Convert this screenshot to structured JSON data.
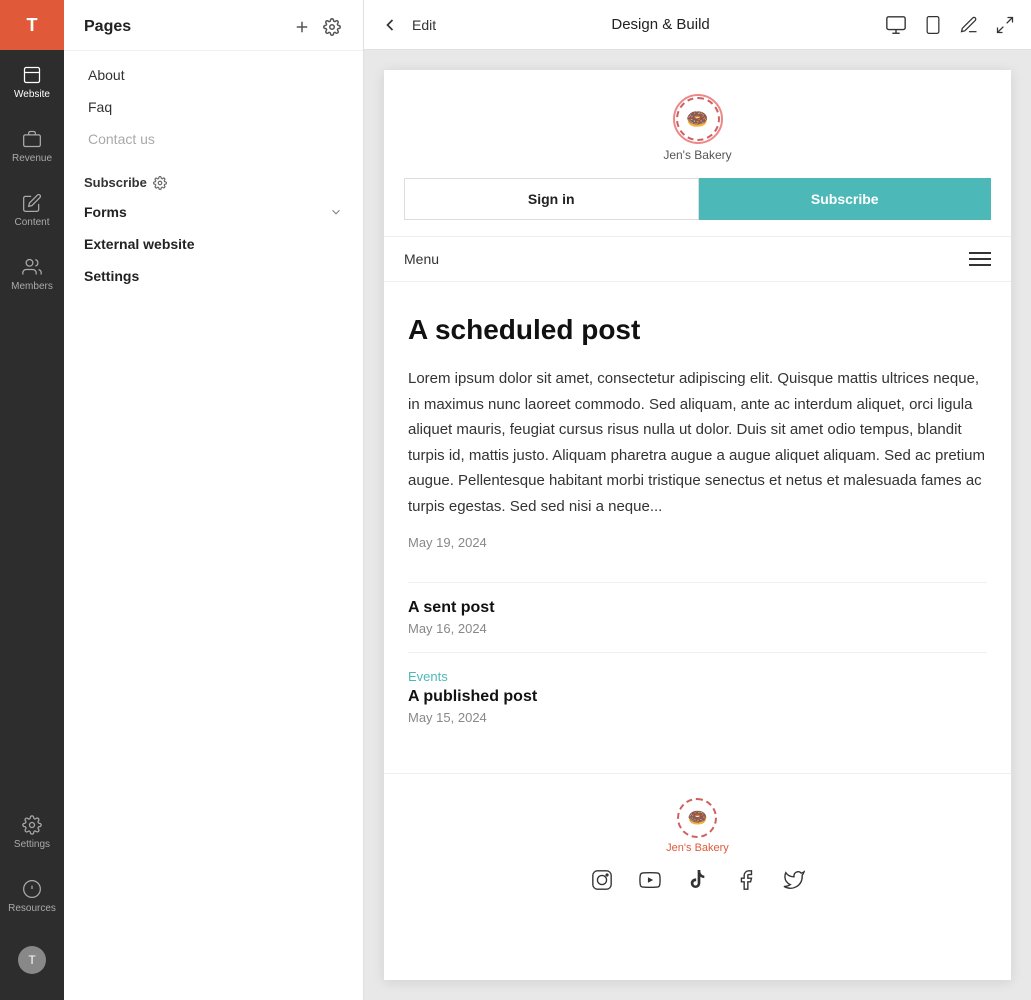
{
  "app": {
    "avatar_initial": "T",
    "top_bar": {
      "back_label": "←",
      "edit_label": "Edit",
      "center_label": "Design & Build"
    },
    "nav_items": [
      {
        "id": "website",
        "label": "Website",
        "active": true
      },
      {
        "id": "revenue",
        "label": "Revenue"
      },
      {
        "id": "content",
        "label": "Content"
      },
      {
        "id": "members",
        "label": "Members"
      }
    ],
    "bottom_nav": [
      {
        "id": "settings",
        "label": "Settings"
      },
      {
        "id": "resources",
        "label": "Resources"
      }
    ]
  },
  "pages_panel": {
    "title": "Pages",
    "pages": [
      {
        "label": "About",
        "dimmed": false
      },
      {
        "label": "Faq",
        "dimmed": false
      },
      {
        "label": "Contact us",
        "dimmed": true
      }
    ],
    "sections": [
      {
        "label": "Subscribe",
        "has_icon": true
      },
      {
        "label": "Forms",
        "has_chevron": true
      },
      {
        "label": "External website"
      },
      {
        "label": "Settings"
      }
    ]
  },
  "preview": {
    "site_name": "Jen's Bakery",
    "nav_label": "Menu",
    "sign_in_label": "Sign in",
    "subscribe_label": "Subscribe",
    "main_post": {
      "title": "A scheduled post",
      "body": "Lorem ipsum dolor sit amet, consectetur adipiscing elit. Quisque mattis ultrices neque, in maximus nunc laoreet commodo. Sed aliquam, ante ac interdum aliquet, orci ligula aliquet mauris, feugiat cursus risus nulla ut dolor. Duis sit amet odio tempus, blandit turpis id, mattis justo. Aliquam pharetra augue a augue aliquet aliquam. Sed ac pretium augue. Pellentesque habitant morbi tristique senectus et netus et malesuada fames ac turpis egestas. Sed sed nisi a neque...",
      "date": "May 19, 2024"
    },
    "posts": [
      {
        "title": "A sent post",
        "date": "May 16, 2024",
        "tag": null
      },
      {
        "title": "A published post",
        "date": "May 15, 2024",
        "tag": "Events"
      }
    ],
    "footer": {
      "site_name": "Jen's Bakery",
      "social_icons": [
        "instagram",
        "youtube",
        "tiktok",
        "facebook",
        "twitter"
      ]
    }
  }
}
